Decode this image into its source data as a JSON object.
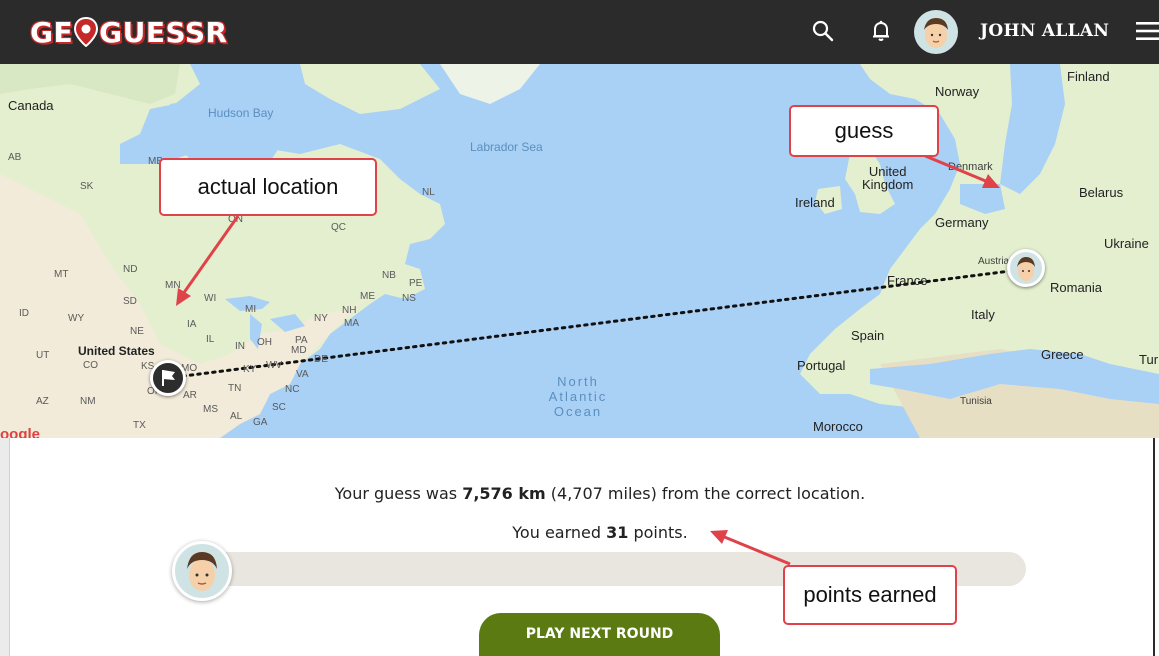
{
  "header": {
    "logo_left": "GE",
    "logo_right": "GUESSR",
    "username": "JOHN ALLAN",
    "icons": [
      "search-icon",
      "bell-icon",
      "avatar",
      "menu-icon"
    ]
  },
  "map": {
    "labels": {
      "canada": "Canada",
      "hudson_bay": "Hudson Bay",
      "labrador_sea": "Labrador Sea",
      "finland": "Finland",
      "norway": "Norway",
      "denmark": "Denmark",
      "united_kingdom": "United\nKingdom",
      "ireland": "Ireland",
      "belarus": "Belarus",
      "germany": "Germany",
      "ukraine": "Ukraine",
      "austria": "Austria",
      "france": "France",
      "romania": "Romania",
      "italy": "Italy",
      "spain": "Spain",
      "greece": "Greece",
      "turkey": "Tur",
      "portugal": "Portugal",
      "tunisia": "Tunisia",
      "morocco": "Morocco",
      "north_atlantic": "North\nAtlantic\nOcean",
      "united_states": "United States",
      "ab": "AB",
      "mb": "MB",
      "sk": "SK",
      "nl": "NL",
      "qc": "QC",
      "on": "ON",
      "mt": "MT",
      "nd": "ND",
      "mn": "MN",
      "sd": "SD",
      "wy": "WY",
      "id": "ID",
      "ne": "NE",
      "ia": "IA",
      "wi": "WI",
      "mi": "MI",
      "il": "IL",
      "in": "IN",
      "oh": "OH",
      "pa": "PA",
      "ny": "NY",
      "nh": "NH",
      "ma": "MA",
      "me": "ME",
      "nb": "NB",
      "pe": "PE",
      "ns": "NS",
      "ut": "UT",
      "co": "CO",
      "ks": "KS",
      "mo": "MO",
      "ky": "KY",
      "wv": "WV",
      "va": "VA",
      "md": "MD",
      "de": "DE",
      "ok": "OK",
      "ar": "AR",
      "tn": "TN",
      "nc": "NC",
      "sc": "SC",
      "ms": "MS",
      "al": "AL",
      "ga": "GA",
      "az": "AZ",
      "nm": "NM",
      "tx": "TX"
    },
    "google_mark": "oogle"
  },
  "callouts": {
    "actual": "actual location",
    "guess": "guess",
    "points": "points earned"
  },
  "result": {
    "line1_prefix": "Your guess was ",
    "distance_km": "7,576 km",
    "line1_suffix": " (4,707 miles) from the correct location.",
    "line2_prefix": "You earned ",
    "points": "31",
    "line2_suffix": " points.",
    "progress_fraction": 0.006,
    "button": "PLAY NEXT ROUND"
  },
  "colors": {
    "header_bg": "#2b2b2b",
    "logo_red": "#c62828",
    "callout_border": "#e0424a",
    "button_bg": "#5b7a12",
    "water": "#a9d0f5",
    "land": "#e3efcf"
  }
}
